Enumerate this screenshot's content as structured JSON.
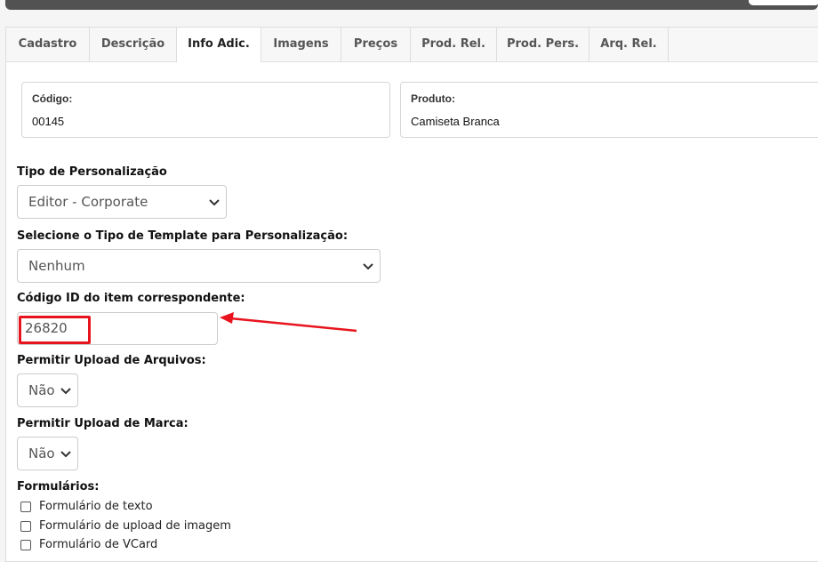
{
  "tabs": [
    {
      "label": "Cadastro"
    },
    {
      "label": "Descrição"
    },
    {
      "label": "Info Adic."
    },
    {
      "label": "Imagens"
    },
    {
      "label": "Preços"
    },
    {
      "label": "Prod. Rel."
    },
    {
      "label": "Prod. Pers."
    },
    {
      "label": "Arq. Rel."
    }
  ],
  "active_tab": "Info Adic.",
  "info": {
    "codigo_label": "Código:",
    "codigo_value": "00145",
    "produto_label": "Produto:",
    "produto_value": "Camiseta Branca"
  },
  "form": {
    "tipo_label": "Tipo de Personalização",
    "tipo_value": "Editor - Corporate",
    "template_label": "Selecione o Tipo de Template para Personalização:",
    "template_value": "Nenhum",
    "codigo_id_label": "Código ID do item correspondente:",
    "codigo_id_value": "26820",
    "upload_arquivos_label": "Permitir Upload de Arquivos:",
    "upload_arquivos_value": "Não",
    "upload_marca_label": "Permitir Upload de Marca:",
    "upload_marca_value": "Não",
    "formularios_label": "Formulários:",
    "formularios": [
      {
        "label": "Formulário de texto",
        "checked": false
      },
      {
        "label": "Formulário de upload de imagem",
        "checked": false
      },
      {
        "label": "Formulário de VCard",
        "checked": false
      }
    ]
  },
  "colors": {
    "annotation": "#e8141d",
    "topbar": "#525252"
  }
}
